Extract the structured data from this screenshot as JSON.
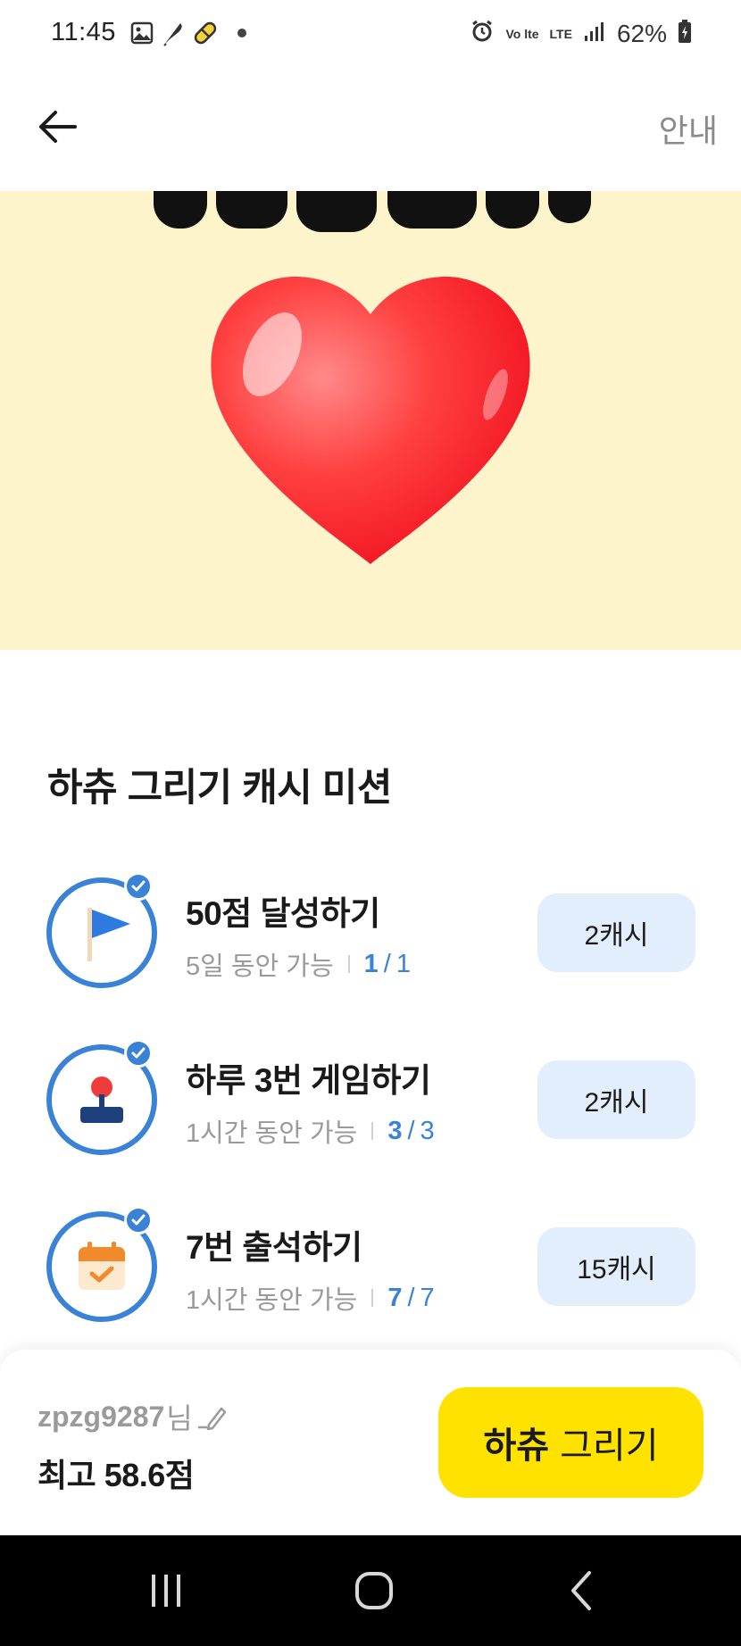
{
  "status_bar": {
    "time": "11:45",
    "battery": "62%",
    "network": "LTE",
    "volte": "Vo lte",
    "icons": [
      "image-icon",
      "feather-icon",
      "capsule-icon",
      "dot-icon",
      "alarm-icon",
      "volte-icon",
      "lte-icon",
      "signal-icon",
      "battery-icon"
    ]
  },
  "header": {
    "back_icon": "arrow-left-icon",
    "info_label": "안내"
  },
  "banner": {
    "background": "#fdf4cb",
    "image": "heart"
  },
  "missions": {
    "title": "하츄 그리기 캐시 미션",
    "items": [
      {
        "title": "50점 달성하기",
        "availability": "5일 동안 가능",
        "done": "1",
        "total": "1",
        "reward": "2캐시",
        "icon": "flag-icon"
      },
      {
        "title": "하루 3번 게임하기",
        "availability": "1시간 동안 가능",
        "done": "3",
        "total": "3",
        "reward": "2캐시",
        "icon": "joystick-icon"
      },
      {
        "title": "7번 출석하기",
        "availability": "1시간 동안 가능",
        "done": "7",
        "total": "7",
        "reward": "15캐시",
        "icon": "calendar-check-icon"
      }
    ]
  },
  "footer": {
    "username": "zpzg9287",
    "username_suffix": "님",
    "best_score": "최고 58.6점",
    "draw_button": {
      "bold": "하츄",
      "rest": "그리기"
    }
  },
  "colors": {
    "accent_blue": "#3a82d6",
    "reward_bg": "#e2eefb",
    "cta_yellow": "#ffe200"
  }
}
